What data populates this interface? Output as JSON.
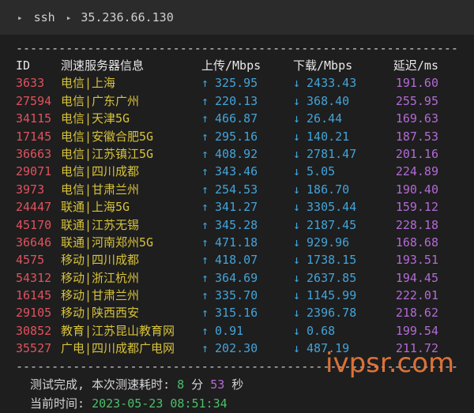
{
  "titlebar": {
    "cmd": "ssh",
    "host": "35.236.66.130"
  },
  "rule": "------------------------------------------------------------------------",
  "header": {
    "id": "ID",
    "server": "测速服务器信息",
    "upload": "上传/Mbps",
    "download": "下载/Mbps",
    "latency": "延迟/ms"
  },
  "rows": [
    {
      "id": "3633",
      "server": "电信|上海",
      "up": "325.95",
      "down": "2433.43",
      "lat": "191.60"
    },
    {
      "id": "27594",
      "server": "电信|广东广州",
      "up": "220.13",
      "down": "368.40",
      "lat": "255.95"
    },
    {
      "id": "34115",
      "server": "电信|天津5G",
      "up": "466.87",
      "down": "26.44",
      "lat": "169.63"
    },
    {
      "id": "17145",
      "server": "电信|安徽合肥5G",
      "up": "295.16",
      "down": "140.21",
      "lat": "187.53"
    },
    {
      "id": "36663",
      "server": "电信|江苏镇江5G",
      "up": "408.92",
      "down": "2781.47",
      "lat": "201.16"
    },
    {
      "id": "29071",
      "server": "电信|四川成都",
      "up": "343.46",
      "down": "5.05",
      "lat": "224.89"
    },
    {
      "id": "3973",
      "server": "电信|甘肃兰州",
      "up": "254.53",
      "down": "186.70",
      "lat": "190.40"
    },
    {
      "id": "24447",
      "server": "联通|上海5G",
      "up": "341.27",
      "down": "3305.44",
      "lat": "159.12"
    },
    {
      "id": "45170",
      "server": "联通|江苏无锡",
      "up": "345.28",
      "down": "2187.45",
      "lat": "228.18"
    },
    {
      "id": "36646",
      "server": "联通|河南郑州5G",
      "up": "471.18",
      "down": "929.96",
      "lat": "168.68"
    },
    {
      "id": "4575",
      "server": "移动|四川成都",
      "up": "418.07",
      "down": "1738.15",
      "lat": "193.51"
    },
    {
      "id": "54312",
      "server": "移动|浙江杭州",
      "up": "364.69",
      "down": "2637.85",
      "lat": "194.45"
    },
    {
      "id": "16145",
      "server": "移动|甘肃兰州",
      "up": "335.70",
      "down": "1145.99",
      "lat": "222.01"
    },
    {
      "id": "29105",
      "server": "移动|陕西西安",
      "up": "315.16",
      "down": "2396.78",
      "lat": "218.62"
    },
    {
      "id": "30852",
      "server": "教育|江苏昆山教育网",
      "up": "0.91",
      "down": "0.68",
      "lat": "199.54"
    },
    {
      "id": "35527",
      "server": "广电|四川成都广电网",
      "up": "202.30",
      "down": "487.19",
      "lat": "211.72"
    }
  ],
  "footer": {
    "done_prefix": "测试完成, 本次测速耗时: ",
    "minutes": "8",
    "min_unit": " 分 ",
    "seconds": "53",
    "sec_unit": " 秒",
    "time_label": "当前时间: ",
    "time_value": "2023-05-23 08:51:34"
  },
  "watermark": "ivpsr.com"
}
